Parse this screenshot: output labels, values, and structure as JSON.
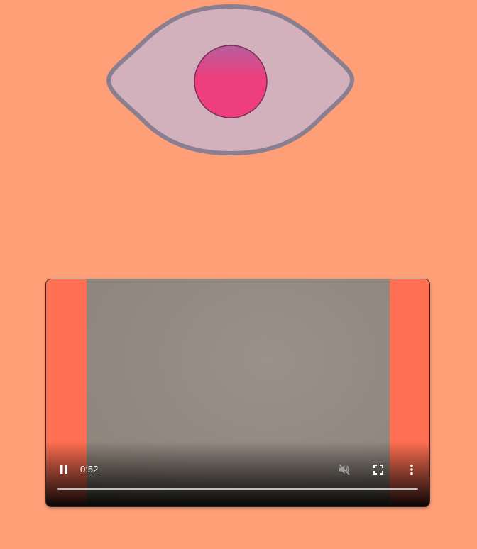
{
  "eye": {
    "icon": "eye-icon",
    "sclera_color": "#d2b0bc",
    "outline_color": "#8a7f90",
    "iris_color_top": "#b65ea0",
    "iris_color_bottom": "#ee3f7c",
    "background_color": "#ff9f77"
  },
  "video": {
    "current_time": "0:52",
    "progress": 1.0,
    "muted": true,
    "playing": true,
    "letterbox_color": "#ff6f52",
    "icons": {
      "play_pause": "pause-icon",
      "mute": "volume-muted-icon",
      "fullscreen": "fullscreen-icon",
      "more": "more-vertical-icon"
    }
  }
}
